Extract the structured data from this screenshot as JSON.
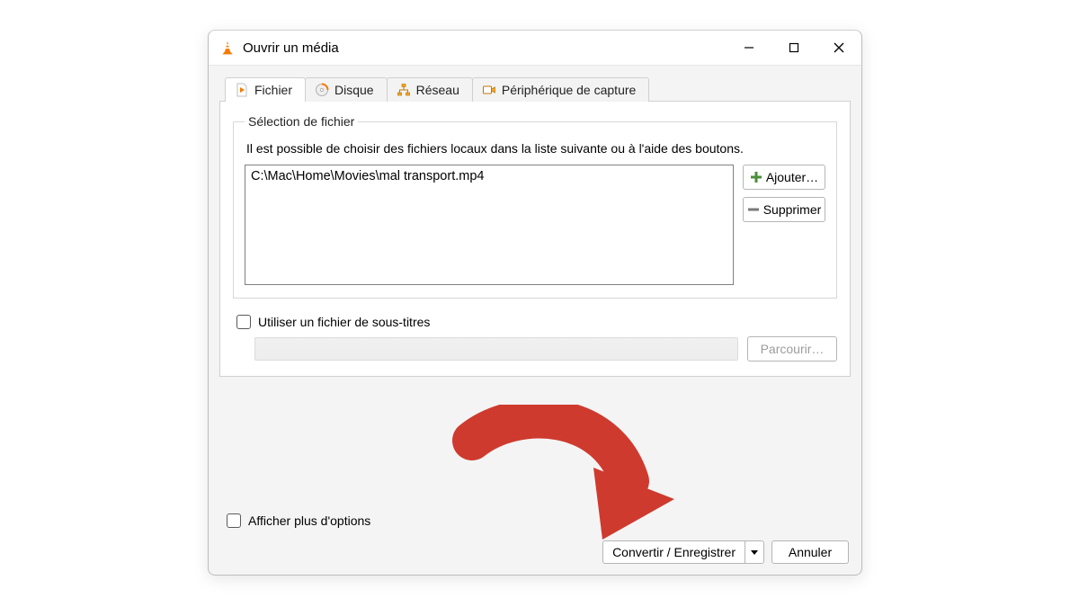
{
  "window": {
    "title": "Ouvrir un média"
  },
  "tabs": {
    "file": {
      "label": "Fichier"
    },
    "disc": {
      "label": "Disque"
    },
    "net": {
      "label": "Réseau"
    },
    "capture": {
      "label": "Périphérique de capture"
    }
  },
  "fileSection": {
    "legend": "Sélection de fichier",
    "instructions": "Il est possible de choisir des fichiers locaux dans la liste suivante ou à l'aide des boutons.",
    "files": [
      "C:\\Mac\\Home\\Movies\\mal transport.mp4"
    ],
    "add_label": "Ajouter…",
    "remove_label": "Supprimer"
  },
  "subtitles": {
    "checkbox_label": "Utiliser un fichier de sous-titres",
    "browse_label": "Parcourir…"
  },
  "more_options_label": "Afficher plus d'options",
  "actions": {
    "convert_label": "Convertir / Enregistrer",
    "cancel_label": "Annuler"
  }
}
